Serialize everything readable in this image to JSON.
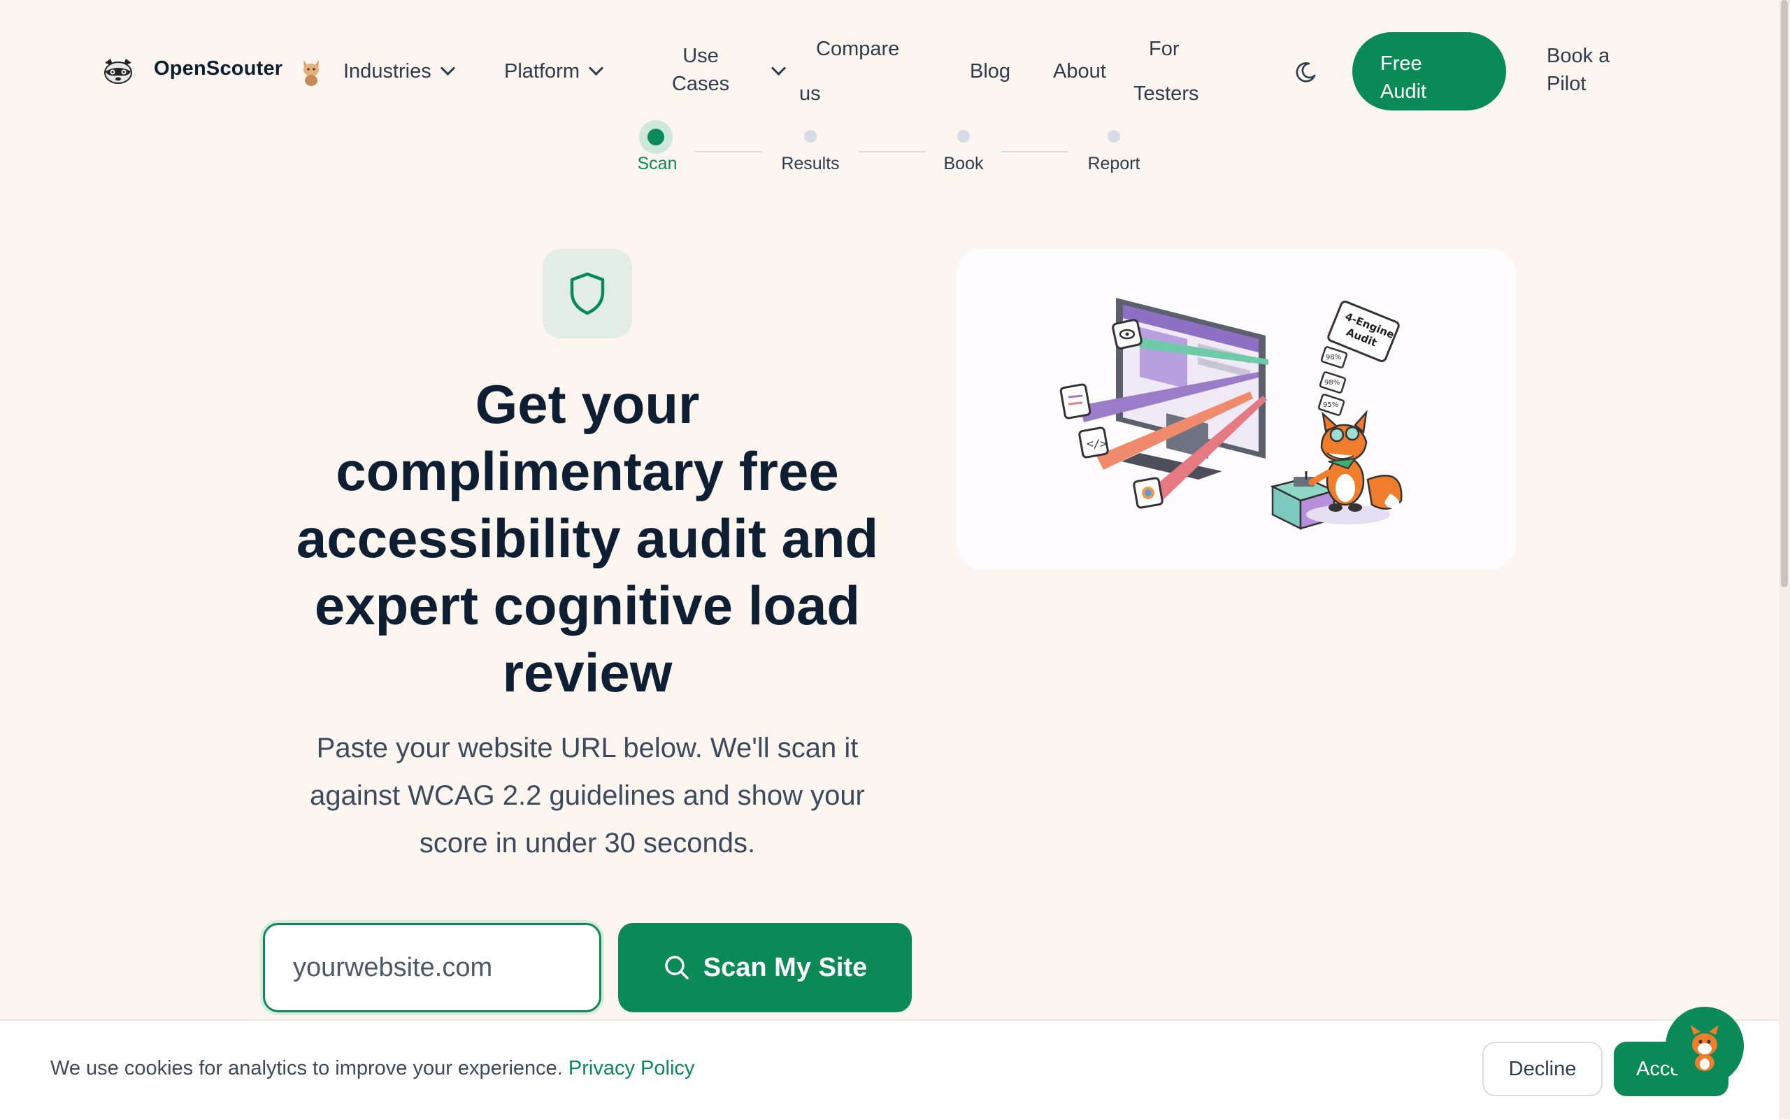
{
  "brand": {
    "name": "OpenScouter"
  },
  "nav": {
    "industries": "Industries",
    "platform": "Platform",
    "use_cases_line1": "Use",
    "use_cases_line2": "Cases",
    "compare_line1": "Compare",
    "compare_line2": "us",
    "blog": "Blog",
    "about": "About",
    "for_testers_line1": "For",
    "for_testers_line2": "Testers",
    "free_audit_line1": "Free",
    "free_audit_line2": "Audit",
    "book_pilot_line1": "Book a",
    "book_pilot_line2": "Pilot"
  },
  "stepper": {
    "steps": [
      {
        "label": "Scan",
        "active": true
      },
      {
        "label": "Results",
        "active": false
      },
      {
        "label": "Book",
        "active": false
      },
      {
        "label": "Report",
        "active": false
      }
    ]
  },
  "hero": {
    "title_lines": [
      "Get your",
      "complimentary free",
      "accessibility audit and",
      "expert cognitive load",
      "review"
    ],
    "subtitle_lines": [
      "Paste your website URL below. We'll scan it",
      "against WCAG 2.2 guidelines and show your",
      "score in under 30 seconds."
    ],
    "url_placeholder": "yourwebsite.com",
    "scan_button": "Scan My Site"
  },
  "illustration": {
    "sign_text_line1": "4-Engine",
    "sign_text_line2": "Audit",
    "chip_1": "98%",
    "chip_2": "95%",
    "chip_3": "98%"
  },
  "cookie": {
    "text": "We use cookies for analytics to improve your experience.",
    "link": "Privacy Policy",
    "decline": "Decline",
    "accept": "Acce"
  },
  "colors": {
    "accent": "#0a8a56",
    "background": "#fdf6f0",
    "heading": "#0f1f33"
  }
}
